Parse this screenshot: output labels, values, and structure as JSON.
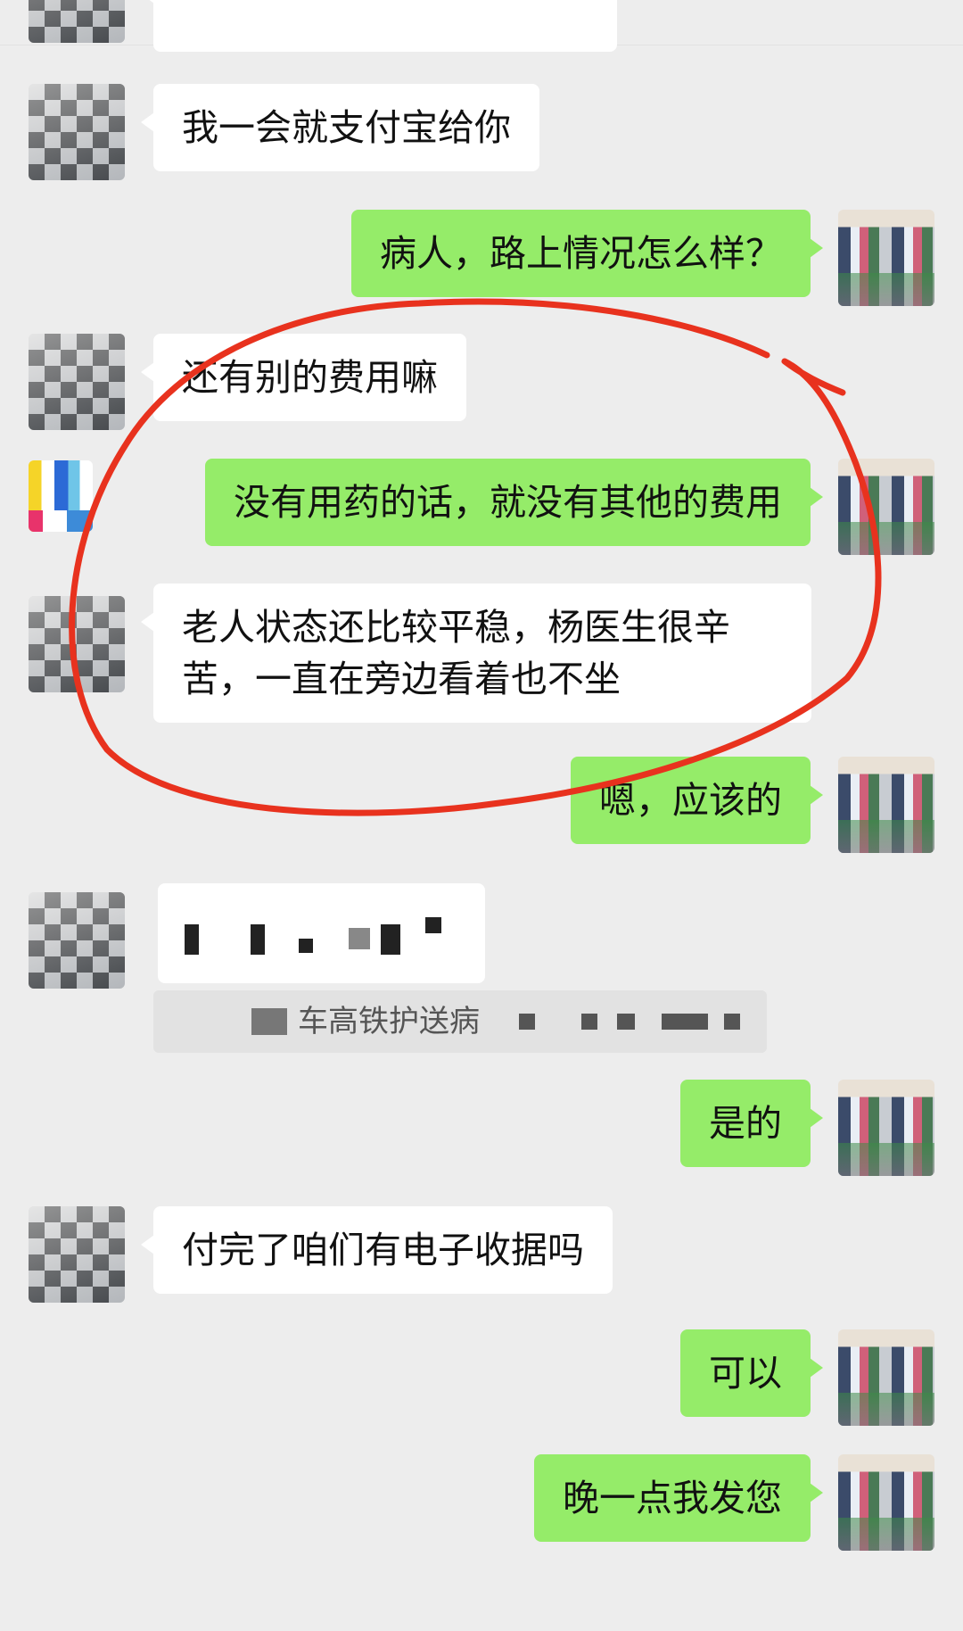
{
  "messages": {
    "m1": "我一会就支付宝给你",
    "m2": "病人，路上情况怎么样？",
    "m3": "还有别的费用嘛",
    "m4": "没有用药的话，就没有其他的费用",
    "m5": "老人状态还比较平稳，杨医生很辛苦，一直在旁边看着也不坐",
    "m6": "嗯，应该的",
    "m7": "是的",
    "m8": "付完了咱们有电子收据吗",
    "m9": "可以",
    "m10": "晚一点我发您"
  },
  "quote": {
    "visible_text": "车高铁护送病"
  },
  "colors": {
    "incoming_bubble": "#ffffff",
    "outgoing_bubble": "#95ec69",
    "background": "#ededed",
    "annotation": "#e8321e"
  }
}
